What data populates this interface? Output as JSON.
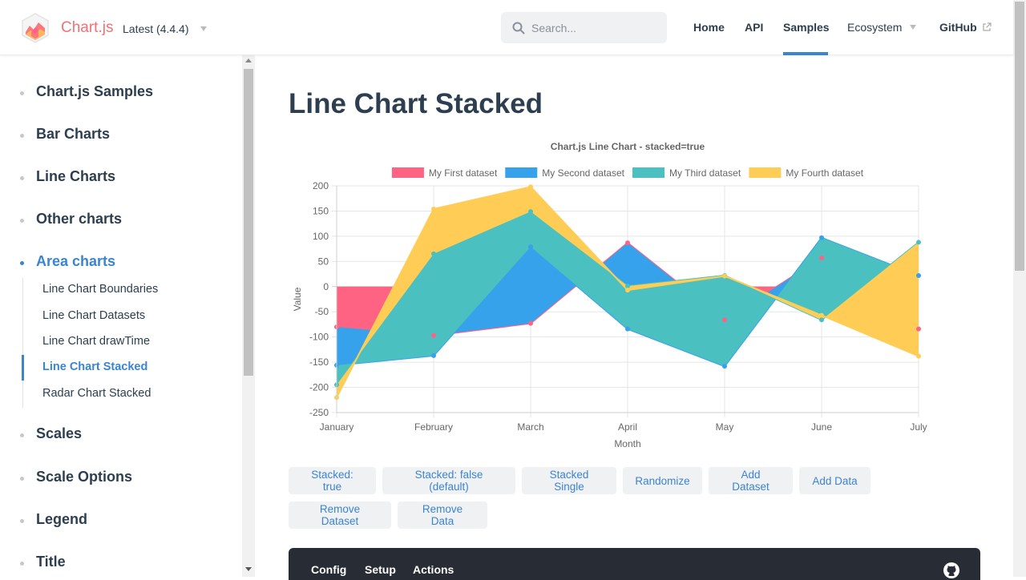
{
  "header": {
    "brand": "Chart.js",
    "version": "Latest (4.4.4)",
    "search_placeholder": "Search...",
    "nav": {
      "home": "Home",
      "api": "API",
      "samples": "Samples",
      "ecosystem": "Ecosystem",
      "github": "GitHub"
    }
  },
  "sidebar": {
    "items": [
      {
        "label": "Chart.js Samples"
      },
      {
        "label": "Bar Charts"
      },
      {
        "label": "Line Charts"
      },
      {
        "label": "Other charts"
      },
      {
        "label": "Area charts"
      },
      {
        "label": "Scales"
      },
      {
        "label": "Scale Options"
      },
      {
        "label": "Legend"
      },
      {
        "label": "Title"
      }
    ],
    "area_children": [
      {
        "label": "Line Chart Boundaries"
      },
      {
        "label": "Line Chart Datasets"
      },
      {
        "label": "Line Chart drawTime"
      },
      {
        "label": "Line Chart Stacked"
      },
      {
        "label": "Radar Chart Stacked"
      }
    ]
  },
  "main": {
    "title": "Line Chart Stacked",
    "buttons": {
      "stacked_true": "Stacked: true",
      "stacked_false": "Stacked: false (default)",
      "stacked_single": "Stacked Single",
      "randomize": "Randomize",
      "add_dataset": "Add Dataset",
      "add_data": "Add Data",
      "remove_dataset": "Remove Dataset",
      "remove_data": "Remove Data"
    },
    "code_tabs": {
      "config": "Config",
      "setup": "Setup",
      "actions": "Actions"
    }
  },
  "colors": {
    "accent": "#3a84d0",
    "brand": "#f27173"
  },
  "chart_data": {
    "type": "area",
    "stacked": true,
    "title": "Chart.js Line Chart - stacked=true",
    "xlabel": "Month",
    "ylabel": "Value",
    "categories": [
      "January",
      "February",
      "March",
      "April",
      "May",
      "June",
      "July"
    ],
    "ylim": [
      -250,
      200
    ],
    "yticks": [
      200,
      150,
      100,
      50,
      0,
      -50,
      -100,
      -150,
      -200,
      -250
    ],
    "legend_position": "top",
    "grid": true,
    "series": [
      {
        "name": "My First dataset",
        "color": "#ff6384",
        "values": [
          -80,
          -97,
          -73,
          87,
          -66,
          57,
          -84
        ]
      },
      {
        "name": "My Second dataset",
        "color": "#36a2eb",
        "values": [
          -76,
          -40,
          152,
          -171,
          -92,
          40,
          106
        ]
      },
      {
        "name": "My Third dataset",
        "color": "#4bc0c0",
        "values": [
          -39,
          202,
          70,
          85,
          180,
          -163,
          66
        ]
      },
      {
        "name": "My Fourth dataset",
        "color": "#ffcd56",
        "values": [
          -25,
          89,
          49,
          -8,
          -1,
          9,
          -226
        ]
      }
    ]
  }
}
